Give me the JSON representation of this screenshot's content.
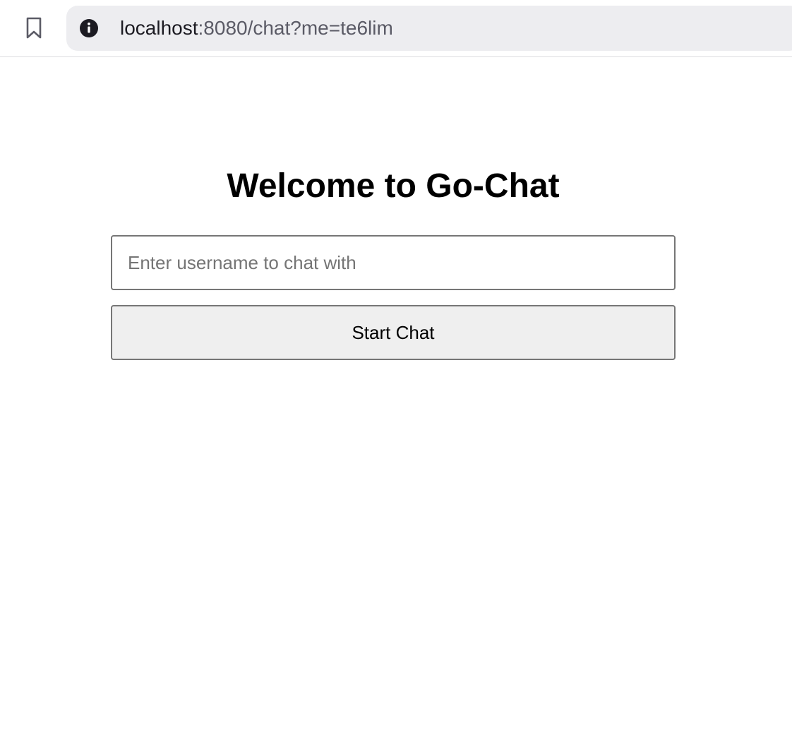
{
  "browser": {
    "url_host": "localhost",
    "url_rest": ":8080/chat?me=te6lim",
    "icons": {
      "bookmark": "bookmark-icon",
      "site_info": "info-icon"
    }
  },
  "page": {
    "title": "Welcome to Go-Chat",
    "username_input": {
      "value": "",
      "placeholder": "Enter username to chat with"
    },
    "start_button_label": "Start Chat"
  },
  "colors": {
    "address_bar_bg": "#ededf0",
    "button_bg": "#efefef",
    "border": "#767676"
  }
}
